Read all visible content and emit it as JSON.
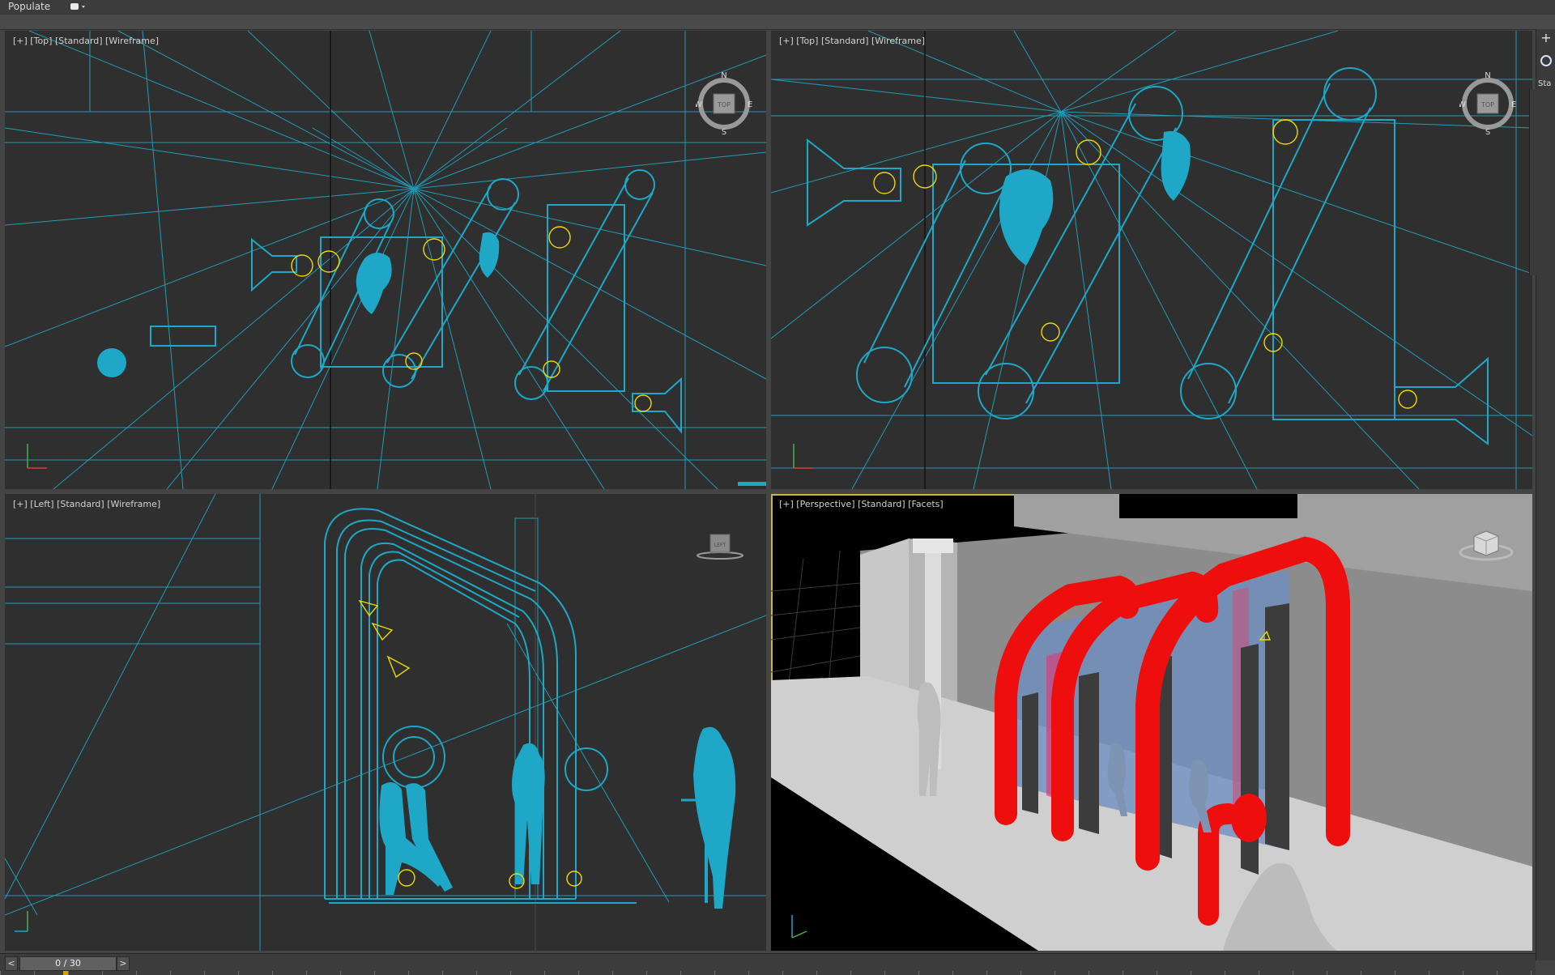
{
  "menubar": {
    "populate_label": "Populate"
  },
  "viewports": {
    "top_left": {
      "label": "[+] [Top] [Standard] [Wireframe]"
    },
    "top_right": {
      "label": "[+] [Top] [Standard] [Wireframe]"
    },
    "bottom_left": {
      "label": "[+] [Left] [Standard] [Wireframe]",
      "cube_label": "LEFT"
    },
    "bottom_right": {
      "label": "[+] [Perspective] [Standard] [Facets]"
    }
  },
  "compass": {
    "n": "N",
    "s": "S",
    "e": "E",
    "w": "W",
    "center": "TOP"
  },
  "command_panel": {
    "plus_icon": "+",
    "tab_text": "Sta"
  },
  "timeline": {
    "prev": "<",
    "next": ">",
    "frame": "0 / 30"
  },
  "colors": {
    "wireframe": "#1fa7c8",
    "lights": "#f0d800",
    "pipe_red": "#ee0e0e",
    "viewport_bg": "#2f2f2f",
    "active_border": "#c9b54a"
  }
}
